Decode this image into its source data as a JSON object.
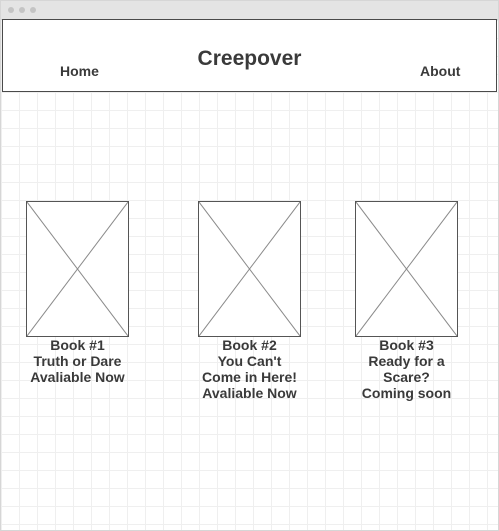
{
  "header": {
    "title": "Creepover",
    "nav": {
      "home": "Home",
      "about": "About"
    }
  },
  "books": [
    {
      "number": "Book #1",
      "title_lines": [
        "Truth or Dare"
      ],
      "status": "Avaliable Now"
    },
    {
      "number": "Book #2",
      "title_lines": [
        "You Can't",
        "Come in Here!"
      ],
      "status": "Avaliable Now"
    },
    {
      "number": "Book #3",
      "title_lines": [
        "Ready for a",
        "Scare?"
      ],
      "status": "Coming soon"
    }
  ],
  "colors": {
    "text": "#3a3a3a",
    "border": "#4a4a4a",
    "placeholder_lines": "#8a8a8a",
    "grid": "#efefef"
  },
  "icons": {
    "book_cover": "image-placeholder-icon"
  }
}
